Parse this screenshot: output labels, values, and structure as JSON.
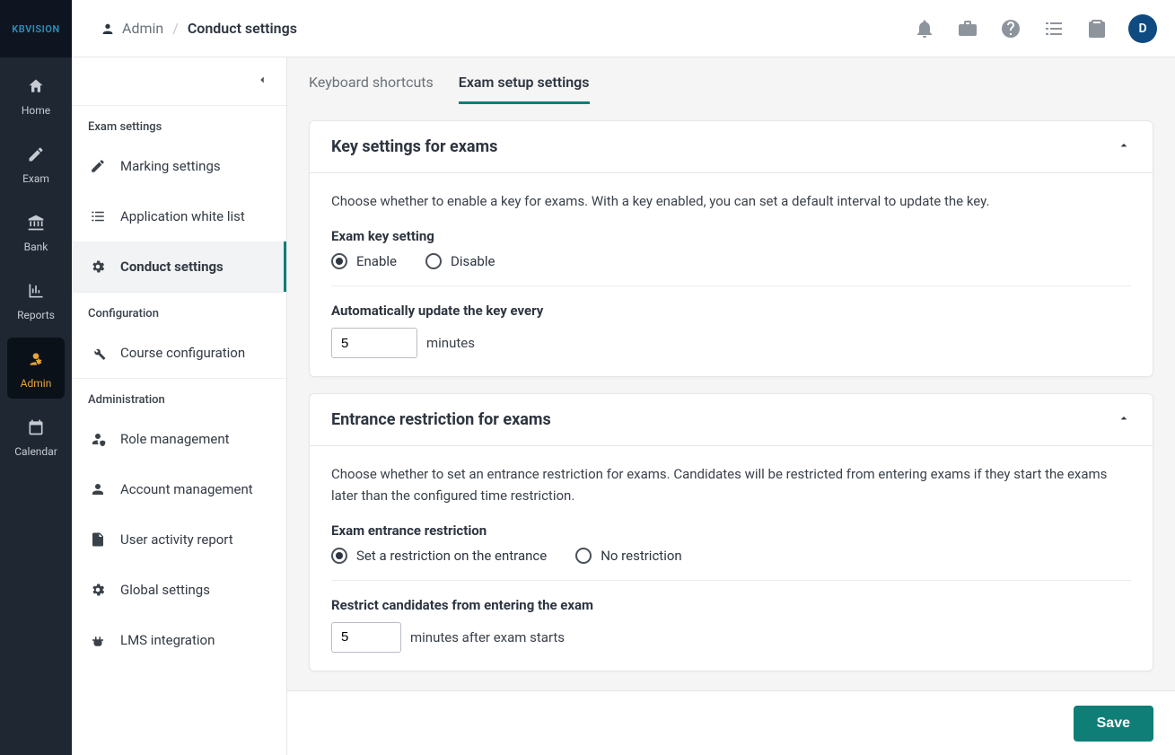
{
  "brand": "KBVISION",
  "avatar_initial": "D",
  "nav": {
    "home": "Home",
    "exam": "Exam",
    "bank": "Bank",
    "reports": "Reports",
    "admin": "Admin",
    "calendar": "Calendar"
  },
  "breadcrumb": {
    "parent": "Admin",
    "current": "Conduct settings"
  },
  "sidebar": {
    "group_exam_settings": "Exam settings",
    "marking_settings": "Marking settings",
    "application_white_list": "Application white list",
    "conduct_settings": "Conduct settings",
    "group_configuration": "Configuration",
    "course_configuration": "Course configuration",
    "group_administration": "Administration",
    "role_management": "Role management",
    "account_management": "Account management",
    "user_activity_report": "User activity report",
    "global_settings": "Global settings",
    "lms_integration": "LMS integration"
  },
  "tabs": {
    "keyboard_shortcuts": "Keyboard shortcuts",
    "exam_setup_settings": "Exam setup settings"
  },
  "key_card": {
    "title": "Key settings for exams",
    "desc": "Choose whether to enable a key for exams. With a key enabled, you can set a default interval to update the key.",
    "radio_label": "Exam key setting",
    "enable": "Enable",
    "disable": "Disable",
    "interval_label": "Automatically update the key every",
    "interval_value": "5",
    "interval_suffix": "minutes"
  },
  "entrance_card": {
    "title": "Entrance restriction for exams",
    "desc": "Choose whether to set an entrance restriction for exams. Candidates will be restricted from entering exams if they start the exams later than the configured time restriction.",
    "radio_label": "Exam entrance restriction",
    "set_restriction": "Set a restriction on the entrance",
    "no_restriction": "No restriction",
    "restrict_label": "Restrict candidates from entering the exam",
    "restrict_value": "5",
    "restrict_suffix": "minutes after exam starts"
  },
  "footer": {
    "save": "Save"
  }
}
